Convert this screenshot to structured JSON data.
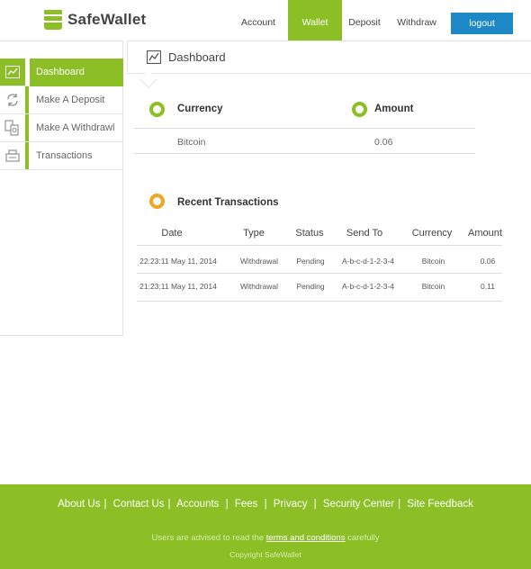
{
  "header": {
    "brand": "SafeWallet",
    "nav": [
      {
        "label": "Account"
      },
      {
        "label": "Wallet",
        "active": true
      },
      {
        "label": "Deposit"
      },
      {
        "label": "Withdraw"
      }
    ],
    "logout_label": "logout"
  },
  "sidebar": {
    "items": [
      {
        "label": "Dashboard",
        "icon": "chart-icon",
        "active": true
      },
      {
        "label": "Make A Deposit",
        "icon": "refresh-icon"
      },
      {
        "label": "Make A Withdrawl",
        "icon": "money-transfer-icon"
      },
      {
        "label": "Transactions",
        "icon": "register-icon"
      }
    ]
  },
  "main": {
    "title": "Dashboard",
    "balance": {
      "currency_header": "Currency",
      "amount_header": "Amount",
      "rows": [
        {
          "currency": "Bitcoin",
          "amount": "0.06"
        }
      ]
    },
    "recent": {
      "title": "Recent Transactions",
      "columns": [
        "Date",
        "Type",
        "Status",
        "Send To",
        "Currency",
        "Amount"
      ],
      "rows": [
        {
          "date": "22:23:11 May 11, 2014",
          "type": "Withdrawal",
          "status": "Pending",
          "send_to": "A-b-c-d-1-2-3-4",
          "currency": "Bitcoin",
          "amount": "0.06"
        },
        {
          "date": "21:23:11 May 11, 2014",
          "type": "Withdrawal",
          "status": "Pending",
          "send_to": "A-b-c-d-1-2-3-4",
          "currency": "Bitcoin",
          "amount": "0.11"
        }
      ]
    }
  },
  "footer": {
    "links": [
      "About Us",
      "Contact Us",
      "Accounts",
      "Fees",
      "Privacy",
      "Security Center",
      "Site Feedback"
    ],
    "note_prefix": "Users are advised to read the",
    "note_link": "terms and conditions",
    "note_suffix": "carefully",
    "copyright": "Copyright SafeWallet"
  },
  "colors": {
    "accent": "#8cbf26",
    "button": "#1e88c7",
    "ring_orange": "#f0a623"
  }
}
